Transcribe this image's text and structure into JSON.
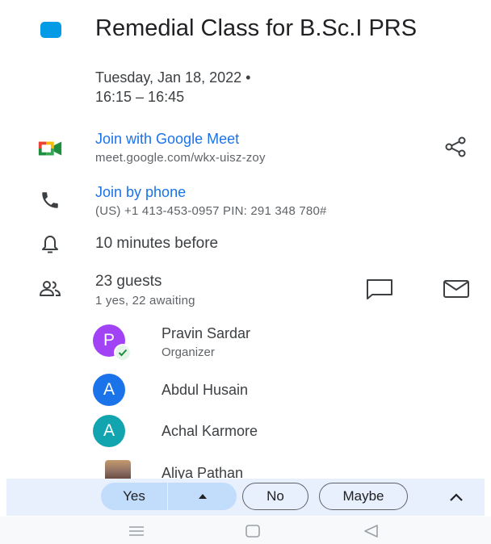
{
  "event": {
    "color": "#039be5",
    "title": "Remedial Class for B.Sc.I PRS",
    "date": "Tuesday, Jan 18, 2022  •",
    "time": "16:15 – 16:45"
  },
  "meet": {
    "icon": "google-meet-icon",
    "label": "Join with Google Meet",
    "url": "meet.google.com/wkx-uisz-zoy"
  },
  "phone": {
    "icon": "phone-icon",
    "label": "Join by phone",
    "details": "(US) +1 413-453-0957 PIN: 291 348 780#"
  },
  "reminder": {
    "icon": "bell-icon",
    "text": "10 minutes before"
  },
  "guests": {
    "icon": "people-icon",
    "count": "23 guests",
    "summary": "1 yes, 22 awaiting",
    "list": [
      {
        "initial": "P",
        "name": "Pravin Sardar",
        "role": "Organizer",
        "color": "#a142f4"
      },
      {
        "initial": "A",
        "name": "Abdul Husain",
        "role": "",
        "color": "#1a73e8"
      },
      {
        "initial": "A",
        "name": "Achal Karmore",
        "role": "",
        "color": "#12a4af"
      },
      {
        "initial": "",
        "name": "Aliya Pathan",
        "role": "",
        "color": "#8d6e63"
      }
    ]
  },
  "rsvp": {
    "yes": "Yes",
    "no": "No",
    "maybe": "Maybe"
  },
  "colors": {
    "accent": "#1a73e8",
    "rsvp_bar": "#e8f0fe",
    "rsvp_yes": "#c2dcfb"
  }
}
